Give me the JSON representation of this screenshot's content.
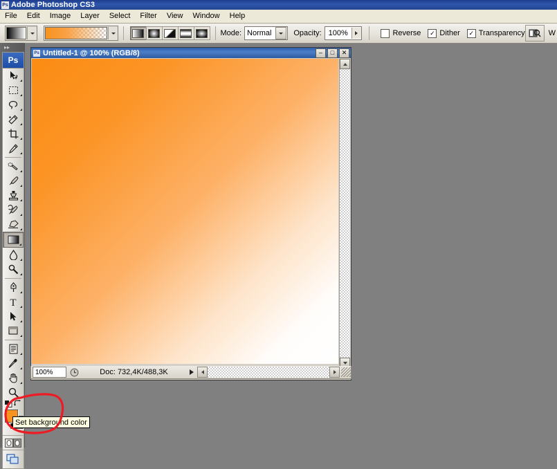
{
  "app": {
    "title": "Adobe Photoshop CS3",
    "icon": "photoshop-icon",
    "logo_text": "Ps"
  },
  "menubar": {
    "items": [
      "File",
      "Edit",
      "Image",
      "Layer",
      "Select",
      "Filter",
      "View",
      "Window",
      "Help"
    ]
  },
  "options_bar": {
    "tool": "gradient-tool",
    "preset_picker_label": "gradient-preset-picker",
    "gradient_swatch_label": "gradient-editor-swatch",
    "gradient_types": [
      {
        "name": "linear-gradient",
        "selected": true
      },
      {
        "name": "radial-gradient",
        "selected": false
      },
      {
        "name": "angle-gradient",
        "selected": false
      },
      {
        "name": "reflected-gradient",
        "selected": false
      },
      {
        "name": "diamond-gradient",
        "selected": false
      }
    ],
    "mode_label": "Mode:",
    "mode_value": "Normal",
    "opacity_label": "Opacity:",
    "opacity_value": "100%",
    "checkboxes": [
      {
        "label": "Reverse",
        "checked": false,
        "mark": ""
      },
      {
        "label": "Dither",
        "checked": true,
        "mark": "✓"
      },
      {
        "label": "Transparency",
        "checked": true,
        "mark": "✓"
      }
    ],
    "bridge_button": "go-to-bridge",
    "workspace_label": "W"
  },
  "tools": {
    "collapse_glyph": "▸▸",
    "items": [
      {
        "name": "move-tool",
        "selected": false
      },
      {
        "name": "rectangular-marquee-tool",
        "selected": false
      },
      {
        "name": "lasso-tool",
        "selected": false
      },
      {
        "name": "magic-wand-tool",
        "selected": false
      },
      {
        "name": "crop-tool",
        "selected": false
      },
      {
        "name": "slice-tool",
        "selected": false
      },
      {
        "name": "healing-brush-tool",
        "selected": false
      },
      {
        "name": "brush-tool",
        "selected": false
      },
      {
        "name": "clone-stamp-tool",
        "selected": false
      },
      {
        "name": "history-brush-tool",
        "selected": false
      },
      {
        "name": "eraser-tool",
        "selected": false
      },
      {
        "name": "gradient-tool",
        "selected": true
      },
      {
        "name": "blur-tool",
        "selected": false
      },
      {
        "name": "dodge-tool",
        "selected": false
      },
      {
        "name": "pen-tool",
        "selected": false
      },
      {
        "name": "horizontal-type-tool",
        "selected": false
      },
      {
        "name": "path-selection-tool",
        "selected": false
      },
      {
        "name": "rectangle-tool",
        "selected": false
      },
      {
        "name": "notes-tool",
        "selected": false
      },
      {
        "name": "eyedropper-tool",
        "selected": false
      },
      {
        "name": "hand-tool",
        "selected": false
      },
      {
        "name": "zoom-tool",
        "selected": false
      }
    ],
    "foreground_color": "#F7931E",
    "background_color": "#000000",
    "default_colors_label": "default-foreground-background-colors",
    "swap_colors_label": "swap-foreground-background-colors",
    "quick_mask_label": "edit-in-quick-mask-mode",
    "screen_mode_label": "change-screen-mode"
  },
  "document": {
    "title": "Untitled-1 @ 100% (RGB/8)",
    "window_buttons": [
      {
        "name": "minimize-button",
        "glyph": "–"
      },
      {
        "name": "maximize-button",
        "glyph": "□"
      },
      {
        "name": "close-button",
        "glyph": "✕"
      }
    ],
    "canvas_description": "orange-to-white-linear-gradient"
  },
  "status_bar": {
    "zoom_value": "100%",
    "clock_icon": "clock-icon",
    "doc_info": "Doc: 732,4K/488,3K",
    "play_glyph": "▸"
  },
  "tooltip": {
    "text": "Set background color"
  },
  "annotation": {
    "name": "red-highlight-circle",
    "color": "#ED1C24"
  },
  "colors": {
    "titlebar_blue": "#24448f",
    "menubar": "#ece9d8",
    "app_background": "#808080",
    "gradient_orange": "#FB8C13",
    "tooltip_bg": "#ffffe1"
  }
}
